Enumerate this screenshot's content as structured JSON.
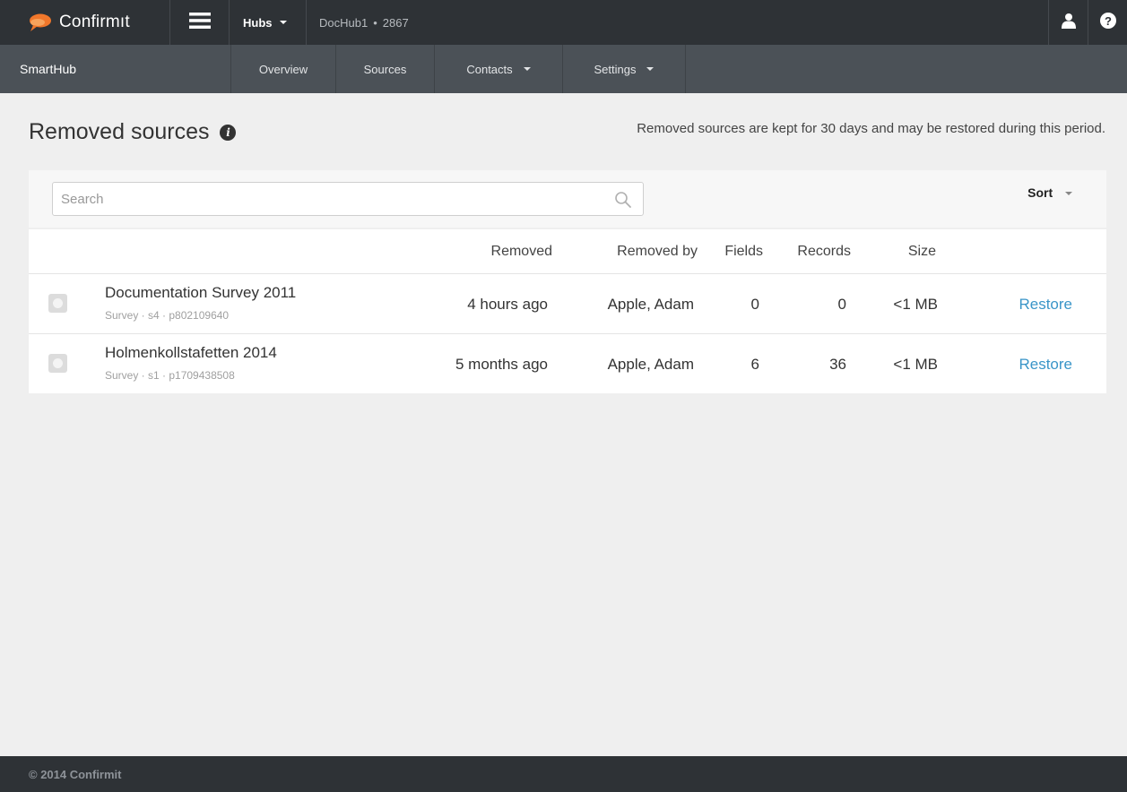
{
  "topbar": {
    "brand": "Confirmıt",
    "hubs_label": "Hubs",
    "hub_name": "DocHub1",
    "hub_separator": "•",
    "hub_id": "2867",
    "colors": {
      "bar": "#2e3236",
      "logo": "#f0772b"
    }
  },
  "subnav": {
    "title": "SmartHub",
    "items": [
      {
        "label": "Overview"
      },
      {
        "label": "Sources"
      },
      {
        "label": "Contacts"
      },
      {
        "label": "Settings"
      }
    ]
  },
  "page": {
    "title": "Removed sources",
    "info_glyph": "i",
    "notice": "Removed sources are kept for 30 days and may be restored during this period."
  },
  "toolbar": {
    "search_placeholder": "Search",
    "sort_label": "Sort"
  },
  "table": {
    "headers": {
      "removed": "Removed",
      "removed_by": "Removed by",
      "fields": "Fields",
      "records": "Records",
      "size": "Size"
    },
    "rows": [
      {
        "name": "Documentation Survey 2011",
        "meta": "Survey · s4 · p802109640",
        "removed": "4 hours ago",
        "removed_by": "Apple, Adam",
        "fields": "0",
        "records": "0",
        "size": "<1 MB",
        "action": "Restore"
      },
      {
        "name": "Holmenkollstafetten 2014",
        "meta": "Survey · s1 · p1709438508",
        "removed": "5 months ago",
        "removed_by": "Apple, Adam",
        "fields": "6",
        "records": "36",
        "size": "<1 MB",
        "action": "Restore"
      }
    ],
    "link_color": "#3a95c8"
  },
  "footer": {
    "copyright": "© 2014 Confirmit"
  }
}
